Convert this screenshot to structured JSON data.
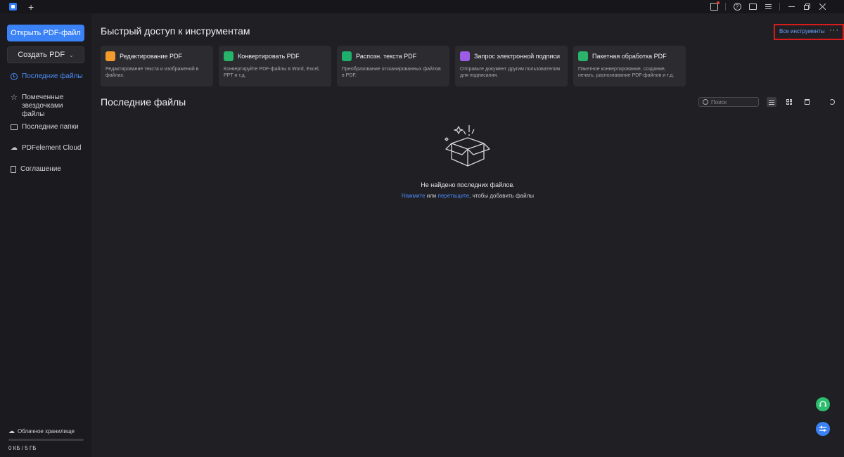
{
  "titlebar": {
    "new_tab": "+",
    "help": "?"
  },
  "sidebar": {
    "open_button": "Открыть PDF-файл",
    "create_button": "Создать PDF",
    "items": [
      {
        "label": "Последние файлы",
        "icon": "clock-icon",
        "active": true
      },
      {
        "label": "Помеченные звездочками файлы",
        "icon": "star-icon",
        "active": false
      },
      {
        "label": "Последние папки",
        "icon": "folder-icon",
        "active": false
      },
      {
        "label": "PDFelement Cloud",
        "icon": "cloud-icon",
        "active": false
      },
      {
        "label": "Соглашение",
        "icon": "document-icon",
        "active": false
      }
    ],
    "storage": {
      "label": "Облачное хранилище",
      "size": "0 КБ / 5 ГБ",
      "used_fraction": 0
    }
  },
  "quick_access": {
    "title": "Быстрый доступ к инструментам",
    "all_tools": "Все инструменты",
    "more": "···",
    "cards": [
      {
        "title": "Редактирование PDF",
        "desc": "Редактирование текста и изображений в файлах.",
        "color": "#f39b2c",
        "icon": "edit-pdf-icon"
      },
      {
        "title": "Конвертировать PDF",
        "desc": "Конвертируйте PDF-файлы в Word, Excel, PPT и т.д.",
        "color": "#27b36a",
        "icon": "convert-pdf-icon"
      },
      {
        "title": "Распозн. текста PDF",
        "desc": "Преобразование отсканированных файлов в PDF.",
        "color": "#1fae6b",
        "icon": "ocr-icon"
      },
      {
        "title": "Запрос электронной подписи",
        "desc": "Отправьте документ другим пользователям для подписания.",
        "color": "#9b5de5",
        "icon": "esign-icon"
      },
      {
        "title": "Пакетная обработка PDF",
        "desc": "Пакетное конвертирование, создание, печать, распознавание PDF-файлов и т.д.",
        "color": "#2cb36b",
        "icon": "batch-icon"
      }
    ]
  },
  "recent": {
    "title": "Последние файлы",
    "search_placeholder": "Поиск",
    "empty_text": "Не найдено последних файлов.",
    "hint_click": "Нажмите",
    "hint_or": " или ",
    "hint_drag": "перетащите",
    "hint_rest": ", чтобы добавить файлы"
  },
  "colors": {
    "accent": "#3b82f6",
    "highlight_box": "#d81c1c",
    "support": "#2dbd6e"
  }
}
